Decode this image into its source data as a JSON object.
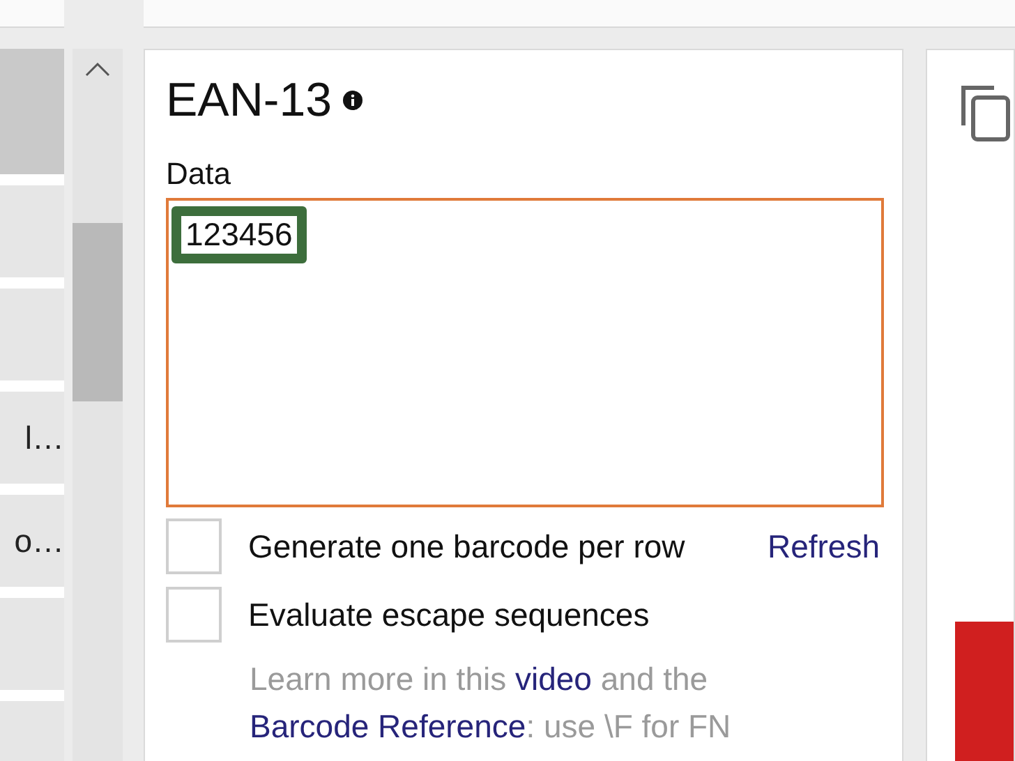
{
  "sidebar": {
    "items": [
      {
        "selected": true
      },
      {
        "selected": false
      },
      {
        "selected": false
      },
      {
        "label": "l…",
        "selected": false
      },
      {
        "label": "o…",
        "selected": false
      },
      {
        "selected": false
      },
      {
        "selected": false
      }
    ]
  },
  "panel": {
    "title": "EAN-13",
    "data_label": "Data",
    "data_value": "123456",
    "options": [
      {
        "label": "Generate one barcode per row",
        "checked": false
      },
      {
        "label": "Evaluate escape sequences",
        "checked": false
      }
    ],
    "refresh_link": "Refresh",
    "help_lines": [
      [
        {
          "kind": "text",
          "text": "Learn more in this "
        },
        {
          "kind": "link",
          "text": "video"
        },
        {
          "kind": "text",
          "text": " and the"
        }
      ],
      [
        {
          "kind": "link",
          "text": "Barcode Reference"
        },
        {
          "kind": "text",
          "text": ": use \\F for FN"
        }
      ]
    ]
  }
}
